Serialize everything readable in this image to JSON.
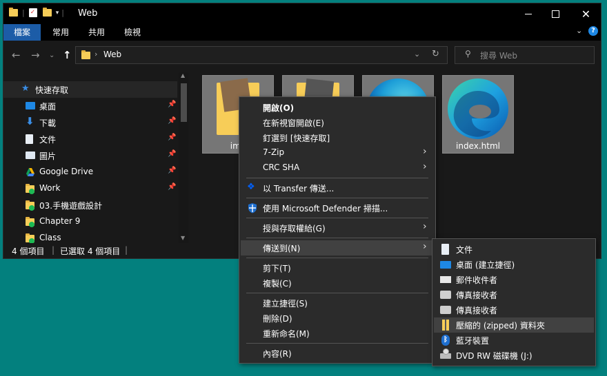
{
  "window": {
    "title": "Web",
    "ribbon_tabs": [
      "檔案",
      "常用",
      "共用",
      "檢視"
    ],
    "address": {
      "path": "Web"
    },
    "search": {
      "placeholder": "搜尋 Web"
    }
  },
  "sidebar": {
    "items": [
      {
        "label": "快速存取",
        "icon": "star-icon",
        "pinned": false
      },
      {
        "label": "桌面",
        "icon": "desktop-icon",
        "pinned": true
      },
      {
        "label": "下載",
        "icon": "download-icon",
        "pinned": true
      },
      {
        "label": "文件",
        "icon": "document-icon",
        "pinned": true
      },
      {
        "label": "圖片",
        "icon": "pictures-icon",
        "pinned": true
      },
      {
        "label": "Google Drive",
        "icon": "google-drive-icon",
        "pinned": true
      },
      {
        "label": "Work",
        "icon": "synced-folder-icon",
        "pinned": true
      },
      {
        "label": "03.手機遊戲設計",
        "icon": "synced-folder-icon",
        "pinned": false
      },
      {
        "label": "Chapter 9",
        "icon": "synced-folder-icon",
        "pinned": false
      },
      {
        "label": "Class",
        "icon": "synced-folder-icon",
        "pinned": false
      }
    ]
  },
  "files": [
    {
      "name": "ima",
      "icon": "image-folder-icon"
    },
    {
      "name": "",
      "icon": "image-folder-icon"
    },
    {
      "name": "",
      "icon": "edge-icon"
    },
    {
      "name": "index.html",
      "icon": "edge-icon"
    }
  ],
  "status": {
    "count": "4 個項目",
    "selected": "已選取 4 個項目"
  },
  "context_menu": {
    "items": [
      {
        "label": "開啟(O)",
        "bold": true
      },
      {
        "label": "在新視窗開啟(E)"
      },
      {
        "label": "釘選到 [快速存取]"
      },
      {
        "label": "7-Zip",
        "submenu": true
      },
      {
        "label": "CRC SHA",
        "submenu": true
      },
      {
        "label": "以 Transfer 傳送...",
        "icon": "dropbox-icon"
      },
      {
        "label": "使用 Microsoft Defender 掃描...",
        "icon": "defender-shield-icon"
      },
      {
        "label": "授與存取權給(G)",
        "submenu": true
      },
      {
        "label": "傳送到(N)",
        "submenu": true,
        "highlighted": true
      },
      {
        "label": "剪下(T)"
      },
      {
        "label": "複製(C)"
      },
      {
        "label": "建立捷徑(S)"
      },
      {
        "label": "刪除(D)"
      },
      {
        "label": "重新命名(M)"
      },
      {
        "label": "內容(R)"
      }
    ]
  },
  "send_to_menu": {
    "items": [
      {
        "label": "文件",
        "icon": "document-icon"
      },
      {
        "label": "桌面 (建立捷徑)",
        "icon": "desktop-icon"
      },
      {
        "label": "郵件收件者",
        "icon": "mail-icon"
      },
      {
        "label": "傳真接收者",
        "icon": "fax-icon"
      },
      {
        "label": "傳真接收者",
        "icon": "fax-icon"
      },
      {
        "label": "壓縮的 (zipped) 資料夾",
        "icon": "zip-folder-icon",
        "highlighted": true
      },
      {
        "label": "藍牙裝置",
        "icon": "bluetooth-icon"
      },
      {
        "label": "DVD RW 磁碟機 (J:)",
        "icon": "dvd-drive-icon"
      }
    ]
  },
  "colors": {
    "accent": "#1c5ca7",
    "desktop": "#03807e",
    "menu_bg": "#2b2b2b",
    "highlight": "#414141"
  }
}
